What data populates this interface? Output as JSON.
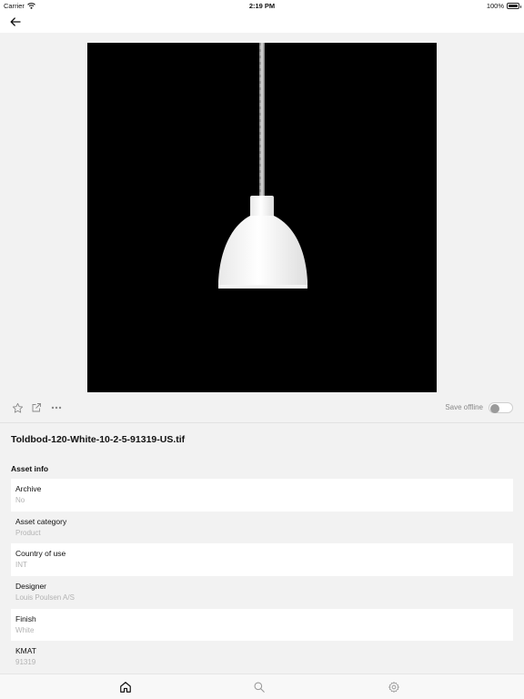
{
  "status_bar": {
    "carrier": "Carrier",
    "time": "2:19 PM",
    "battery": "100%"
  },
  "nav": {
    "back_icon": "arrow-left-icon"
  },
  "preview": {
    "background": "#000000",
    "subject": "white pendant lamp"
  },
  "actions": {
    "favorite_icon": "star-icon",
    "share_icon": "external-link-icon",
    "more_icon": "more-horizontal-icon",
    "save_offline_label": "Save offline",
    "save_offline_enabled": false
  },
  "file_name": "Toldbod-120-White-10-2-5-91319-US.tif",
  "asset_info": {
    "title": "Asset info",
    "rows": [
      {
        "label": "Archive",
        "value": "No"
      },
      {
        "label": "Asset category",
        "value": "Product"
      },
      {
        "label": "Country of use",
        "value": "INT"
      },
      {
        "label": "Designer",
        "value": "Louis Poulsen A/S"
      },
      {
        "label": "Finish",
        "value": "White"
      },
      {
        "label": "KMAT",
        "value": "91319"
      }
    ]
  },
  "tab_bar": {
    "tabs": [
      {
        "name": "home",
        "icon": "home-icon",
        "active": true
      },
      {
        "name": "search",
        "icon": "search-icon",
        "active": false
      },
      {
        "name": "settings",
        "icon": "gear-icon",
        "active": false
      }
    ]
  },
  "colors": {
    "background": "#f2f2f2",
    "row_white": "#ffffff",
    "value_text": "#b3b3b3",
    "toggle_knob": "#9a9a9a"
  }
}
